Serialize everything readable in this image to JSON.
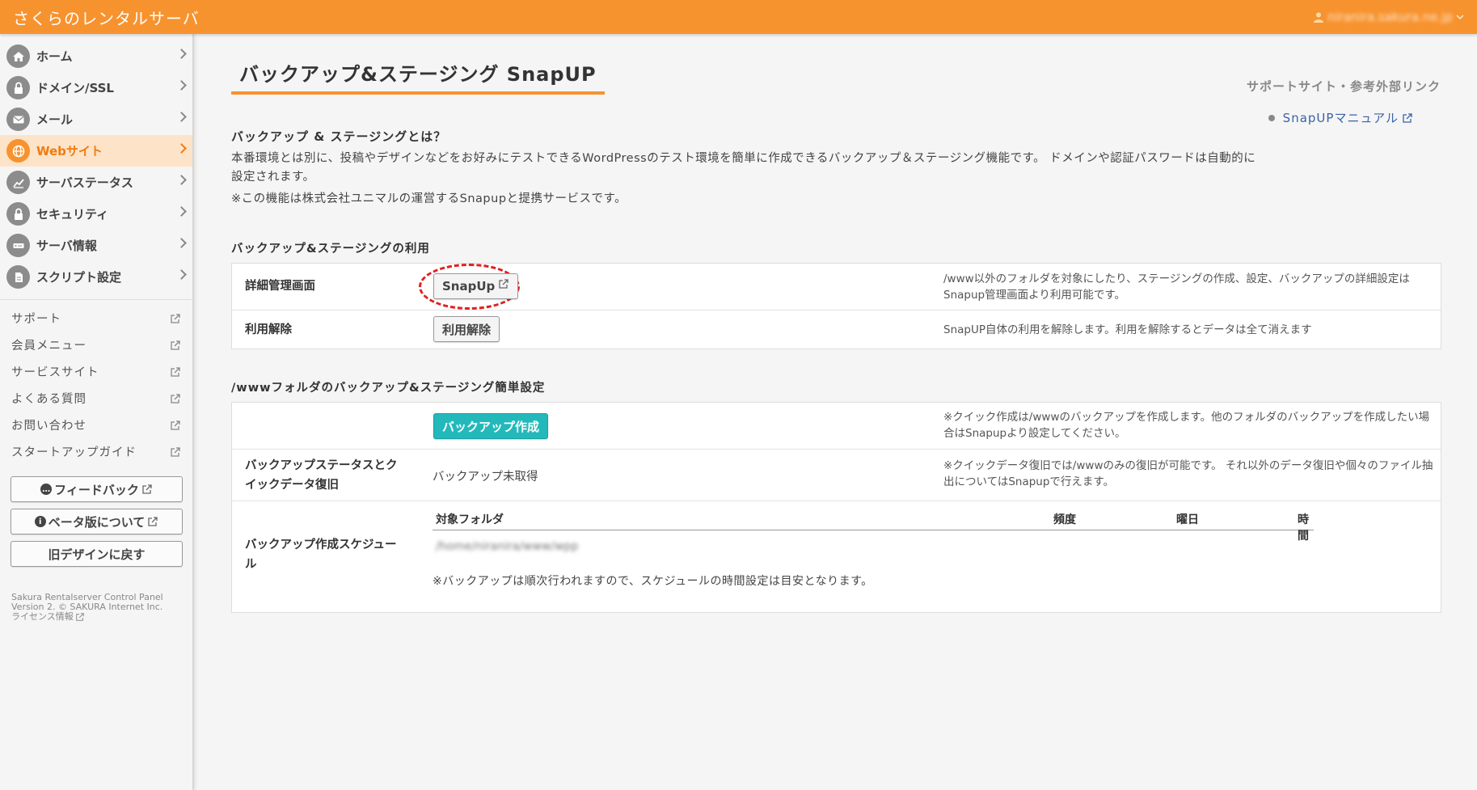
{
  "header": {
    "brand": "さくらのレンタルサーバ",
    "user": "niranira.sakura.ne.jp"
  },
  "sidebar": {
    "nav": [
      {
        "label": "ホーム",
        "icon": "home-icon",
        "active": false
      },
      {
        "label": "ドメイン/SSL",
        "icon": "lock-icon",
        "active": false
      },
      {
        "label": "メール",
        "icon": "mail-icon",
        "active": false
      },
      {
        "label": "Webサイト",
        "icon": "globe-icon",
        "active": true
      },
      {
        "label": "サーバステータス",
        "icon": "chart-icon",
        "active": false
      },
      {
        "label": "セキュリティ",
        "icon": "padlock-icon",
        "active": false
      },
      {
        "label": "サーバ情報",
        "icon": "server-icon",
        "active": false
      },
      {
        "label": "スクリプト設定",
        "icon": "script-icon",
        "active": false
      }
    ],
    "links": [
      "サポート",
      "会員メニュー",
      "サービスサイト",
      "よくある質問",
      "お問い合わせ",
      "スタートアップガイド"
    ],
    "buttons": {
      "feedback": "フィードバック",
      "beta": "ベータ版について",
      "old_design": "旧デザインに戻す"
    },
    "footer": {
      "line1": "Sakura Rentalserver Control Panel",
      "line2": "Version 2. © SAKURA Internet Inc.",
      "license": "ライセンス情報"
    }
  },
  "main": {
    "title": "バックアップ&ステージング SnapUP",
    "support": {
      "heading": "サポートサイト・参考外部リンク",
      "link": "SnapUPマニュアル"
    },
    "intro": {
      "heading": "バックアップ & ステージングとは？",
      "body": "本番環境とは別に、投稿やデザインなどをお好みにテストできるWordPressのテスト環境を簡単に作成できるバックアップ＆ステージング機能です。 ドメインや認証パスワードは自動的に設定されます。",
      "note": "※この機能は株式会社ユニマルの運営するSnapupと提携サービスです。"
    },
    "usage": {
      "title": "バックアップ&ステージングの利用",
      "rows": [
        {
          "label": "詳細管理画面",
          "button": "SnapUp",
          "desc": "/www以外のフォルダを対象にしたり、ステージングの作成、設定、バックアップの詳細設定はSnapup管理画面より利用可能です。"
        },
        {
          "label": "利用解除",
          "button": "利用解除",
          "desc": "SnapUP自体の利用を解除します。利用を解除するとデータは全て消えます"
        }
      ]
    },
    "quick": {
      "title": "/wwwフォルダのバックアップ&ステージング簡単設定",
      "create_button": "バックアップ作成",
      "create_desc": "※クイック作成は/wwwのバックアップを作成します。他のフォルダのバックアップを作成したい場合はSnapupより設定してください。",
      "status_label": "バックアップステータスとクイックデータ復旧",
      "status_value": "バックアップ未取得",
      "status_desc": "※クイックデータ復旧では/wwwのみの復旧が可能です。 それ以外のデータ復旧や個々のファイル抽出についてはSnapupで行えます。",
      "schedule_label": "バックアップ作成スケジュール",
      "schedule_headers": [
        "対象フォルダ",
        "頻度",
        "曜日",
        "時間"
      ],
      "schedule_folder": "/home/niranira/www/wpp",
      "schedule_note": "※バックアップは順次行われますので、スケジュールの時間設定は目安となります。"
    }
  }
}
